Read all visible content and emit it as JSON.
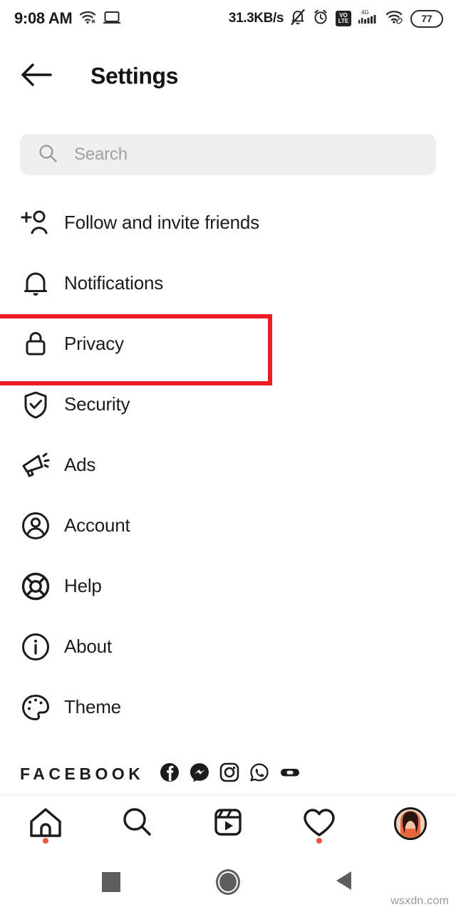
{
  "status_bar": {
    "time": "9:08 AM",
    "network_speed": "31.3KB/s",
    "battery_level": "77",
    "volte_top": "VO",
    "volte_bottom": "LTE",
    "signal_generation": "4G",
    "icons": [
      "wifi-icon",
      "cast-screen-icon",
      "bell-muted-icon",
      "alarm-clock-icon",
      "volte-icon",
      "cellular-signal-icon",
      "wifi-tethering-icon",
      "battery-icon"
    ]
  },
  "header": {
    "title": "Settings",
    "back_icon": "arrow-left-icon"
  },
  "search": {
    "placeholder": "Search",
    "value": "",
    "icon": "search-icon"
  },
  "menu": {
    "items": [
      {
        "label": "Follow and invite friends",
        "icon": "person-add-icon",
        "highlighted": false
      },
      {
        "label": "Notifications",
        "icon": "bell-icon",
        "highlighted": false
      },
      {
        "label": "Privacy",
        "icon": "lock-icon",
        "highlighted": true
      },
      {
        "label": "Security",
        "icon": "shield-check-icon",
        "highlighted": false
      },
      {
        "label": "Ads",
        "icon": "megaphone-icon",
        "highlighted": false
      },
      {
        "label": "Account",
        "icon": "person-circle-icon",
        "highlighted": false
      },
      {
        "label": "Help",
        "icon": "life-ring-icon",
        "highlighted": false
      },
      {
        "label": "About",
        "icon": "info-circle-icon",
        "highlighted": false
      },
      {
        "label": "Theme",
        "icon": "palette-icon",
        "highlighted": false
      }
    ]
  },
  "footer": {
    "brand_label": "FACEBOOK",
    "brand_icons": [
      "facebook-icon",
      "messenger-icon",
      "instagram-icon",
      "whatsapp-icon",
      "oculus-icon"
    ]
  },
  "bottom_nav": {
    "items": [
      {
        "name": "home",
        "icon": "home-icon",
        "badge": true
      },
      {
        "name": "search",
        "icon": "search-icon",
        "badge": false
      },
      {
        "name": "reels",
        "icon": "reels-icon",
        "badge": false
      },
      {
        "name": "activity",
        "icon": "heart-icon",
        "badge": true
      },
      {
        "name": "profile",
        "icon": "avatar-icon",
        "badge": false
      }
    ]
  },
  "android_nav": {
    "recents_icon": "square-icon",
    "home_icon": "circle-icon",
    "back_icon": "triangle-back-icon"
  },
  "watermark": "wsxdn.com",
  "colors": {
    "highlight": "#ee1c25",
    "badge": "#e8563f",
    "search_bg": "#efefef",
    "text": "#1c1c1c"
  }
}
